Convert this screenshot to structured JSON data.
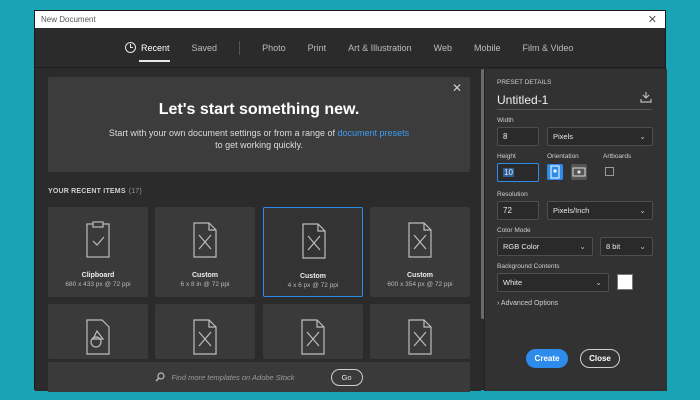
{
  "window": {
    "title": "New Document"
  },
  "tabs": [
    {
      "label": "Recent"
    },
    {
      "label": "Saved"
    },
    {
      "label": "Photo"
    },
    {
      "label": "Print"
    },
    {
      "label": "Art & Illustration"
    },
    {
      "label": "Web"
    },
    {
      "label": "Mobile"
    },
    {
      "label": "Film & Video"
    }
  ],
  "hero": {
    "title": "Let's start something new.",
    "line1_prefix": "Start with your own document settings or from a range of ",
    "line1_link": "document presets",
    "line2": "to get working quickly."
  },
  "recent": {
    "header": "YOUR RECENT ITEMS",
    "count": "(17)",
    "items": [
      {
        "name": "Clipboard",
        "desc": "680 x 433 px @ 72 ppi"
      },
      {
        "name": "Custom",
        "desc": "6 x 8 in @ 72 ppi"
      },
      {
        "name": "Custom",
        "desc": "4 x 6 px @ 72 ppi"
      },
      {
        "name": "Custom",
        "desc": "600 x 354 px @ 72 ppi"
      }
    ]
  },
  "stock": {
    "placeholder": "Find more templates on Adobe Stock",
    "go_label": "Go"
  },
  "preset": {
    "section_label": "PRESET DETAILS",
    "name": "Untitled-1",
    "width_label": "Width",
    "width_value": "8",
    "width_unit": "Pixels",
    "height_label": "Height",
    "height_value": "10",
    "orientation_label": "Orientation",
    "artboards_label": "Artboards",
    "resolution_label": "Resolution",
    "resolution_value": "72",
    "resolution_unit": "Pixels/Inch",
    "color_mode_label": "Color Mode",
    "color_mode_value": "RGB Color",
    "bit_depth_value": "8 bit",
    "background_label": "Background Contents",
    "background_value": "White",
    "advanced_label": "Advanced Options"
  },
  "buttons": {
    "create": "Create",
    "close": "Close"
  },
  "colors": {
    "accent": "#2d8ceb",
    "link": "#3d9cf3",
    "desktop": "#1aa3b5"
  }
}
